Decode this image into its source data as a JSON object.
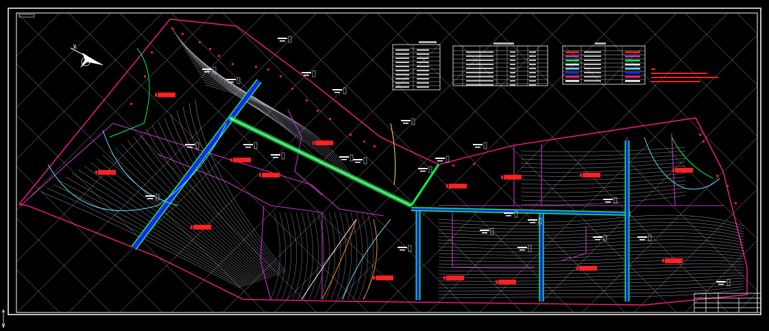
{
  "drawing": {
    "background": "#000000",
    "colors": {
      "frame": "#ffffff",
      "boundary": "#ff1a8c",
      "contour": "#e8e8ff",
      "parcel": "#cc33cc",
      "road": "#2222ff",
      "road_edge": "#00ff44",
      "label_red": "#ff2020",
      "cyan_line": "#66ddff",
      "orange_line": "#ff8833",
      "yellow_line": "#ffee33",
      "grid": "#bfbfbf"
    },
    "icons": [
      "north-arrow-icon",
      "ucs-axis-icon"
    ]
  }
}
